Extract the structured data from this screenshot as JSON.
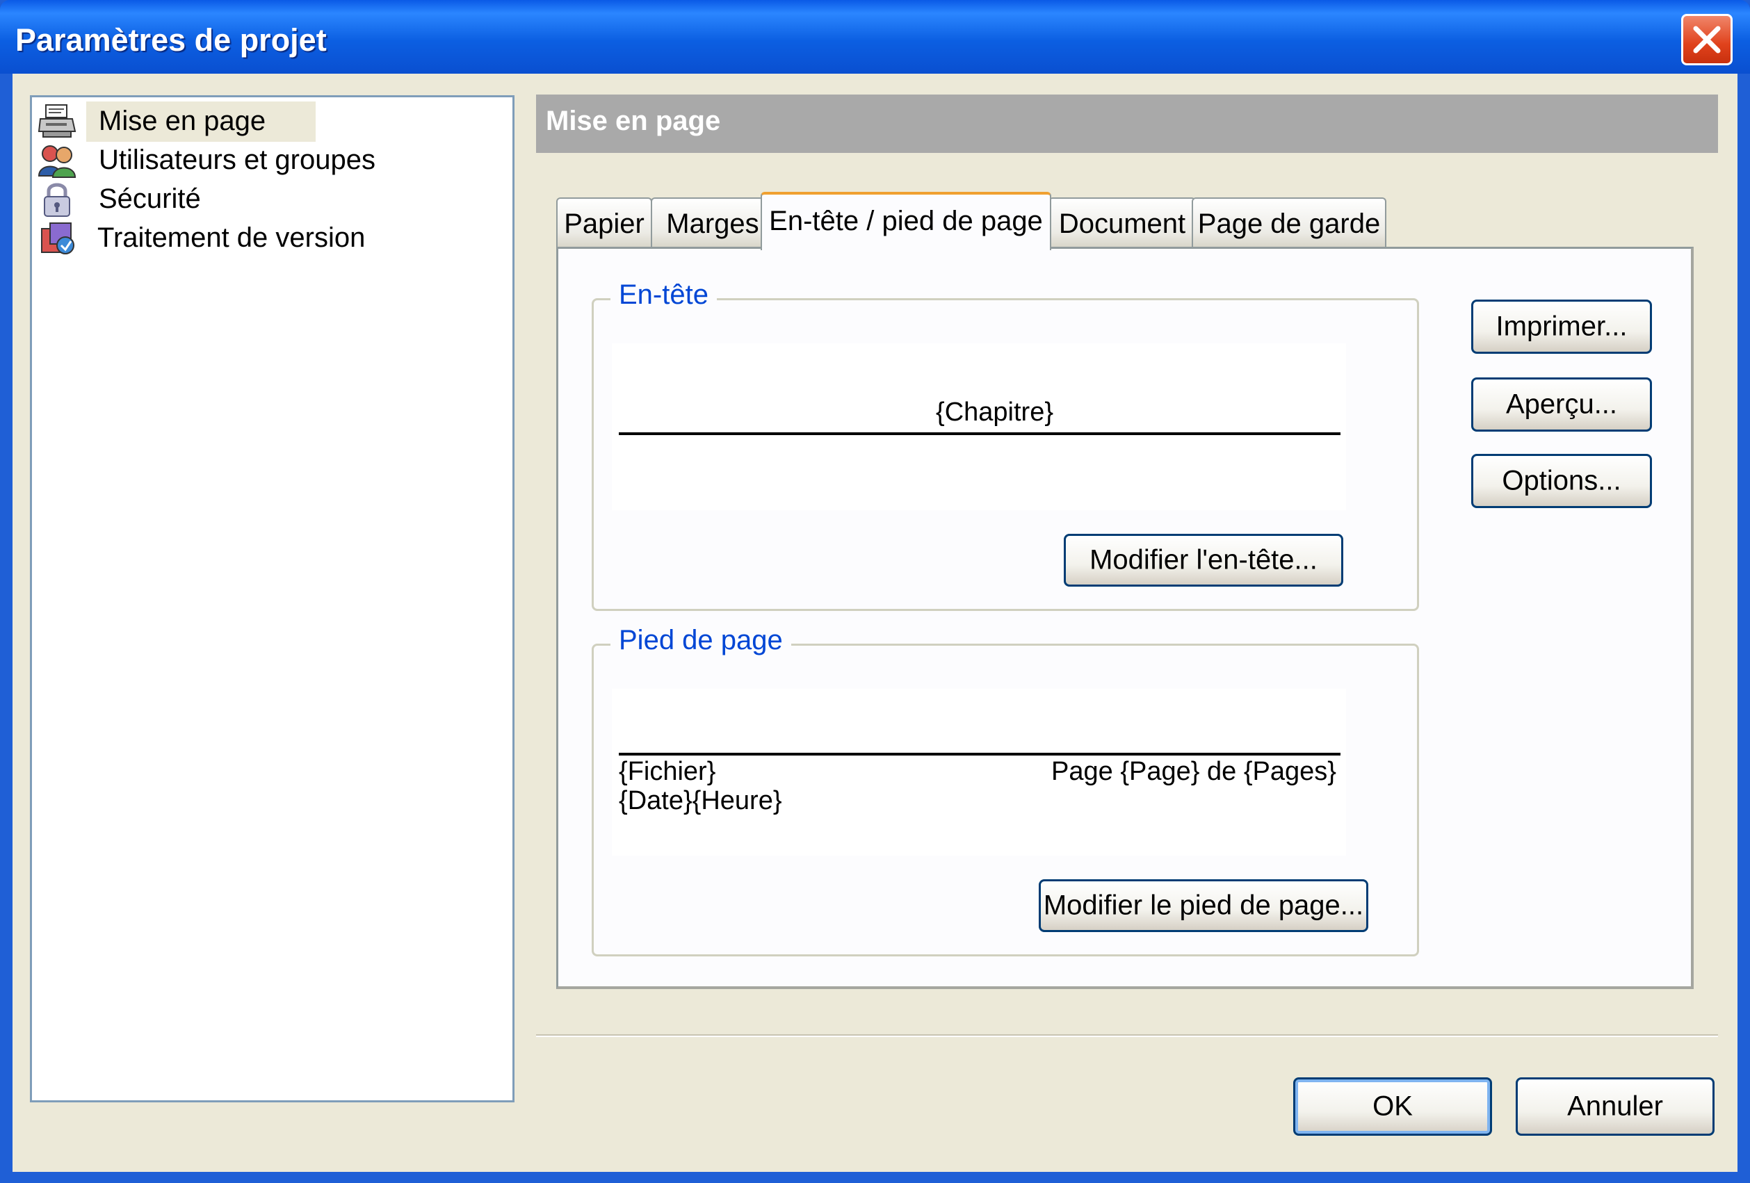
{
  "window": {
    "title": "Paramètres de projet"
  },
  "tree": {
    "items": [
      {
        "label": "Mise en page",
        "icon": "printer-icon",
        "selected": true
      },
      {
        "label": "Utilisateurs et groupes",
        "icon": "users-icon",
        "selected": false
      },
      {
        "label": "Sécurité",
        "icon": "lock-icon",
        "selected": false
      },
      {
        "label": "Traitement de version",
        "icon": "version-icon",
        "selected": false
      }
    ]
  },
  "panel": {
    "header": "Mise en page"
  },
  "tabs": [
    {
      "label": "Papier",
      "active": false
    },
    {
      "label": "Marges",
      "active": false
    },
    {
      "label": "En-tête / pied de page",
      "active": true
    },
    {
      "label": "Document",
      "active": false
    },
    {
      "label": "Page de garde",
      "active": false
    }
  ],
  "header_group": {
    "label": "En-tête",
    "preview_center": "{Chapitre}",
    "edit_button": "Modifier l'en-tête..."
  },
  "footer_group": {
    "label": "Pied de page",
    "preview_left_line1": "{Fichier}",
    "preview_left_line2": "{Date}{Heure}",
    "preview_right": "Page {Page} de {Pages}",
    "edit_button": "Modifier le pied de page..."
  },
  "side_buttons": {
    "print": "Imprimer...",
    "preview": "Aperçu...",
    "options": "Options..."
  },
  "footer_buttons": {
    "ok": "OK",
    "cancel": "Annuler"
  },
  "colors": {
    "title_bar": "#0a5ae6",
    "dialog_bg": "#ece9d8",
    "group_label": "#0046d5",
    "active_tab_accent": "#f0a030"
  }
}
